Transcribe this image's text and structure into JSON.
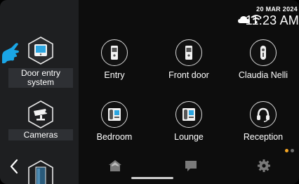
{
  "status_bar": {
    "date": "20 MAR 2024",
    "time": "11:23 AM",
    "icons": [
      "cloud-icon",
      "wifi-icon"
    ]
  },
  "sidebar": {
    "items": [
      {
        "label": "Door entry system",
        "icon": "door-entry-monitor-icon",
        "active": true
      },
      {
        "label": "Cameras",
        "icon": "camera-icon",
        "active": false
      }
    ],
    "pointer_icon": "pointing-hand-icon",
    "back_icon": "chevron-left-icon"
  },
  "grid": {
    "tiles": [
      {
        "label": "Entry",
        "icon": "outdoor-panel-icon"
      },
      {
        "label": "Front door",
        "icon": "outdoor-panel-icon"
      },
      {
        "label": "Claudia Nelli",
        "icon": "door-lock-icon"
      },
      {
        "label": "Bedroom",
        "icon": "indoor-phone-icon"
      },
      {
        "label": "Lounge",
        "icon": "indoor-phone-icon"
      },
      {
        "label": "Reception",
        "icon": "headset-icon"
      }
    ]
  },
  "pagination": {
    "pages": 2,
    "current": 1,
    "active_color": "#f5a623",
    "inactive_color": "#6e6e6e"
  },
  "bottom_nav": [
    "home-icon",
    "chat-icon",
    "settings-icon"
  ]
}
